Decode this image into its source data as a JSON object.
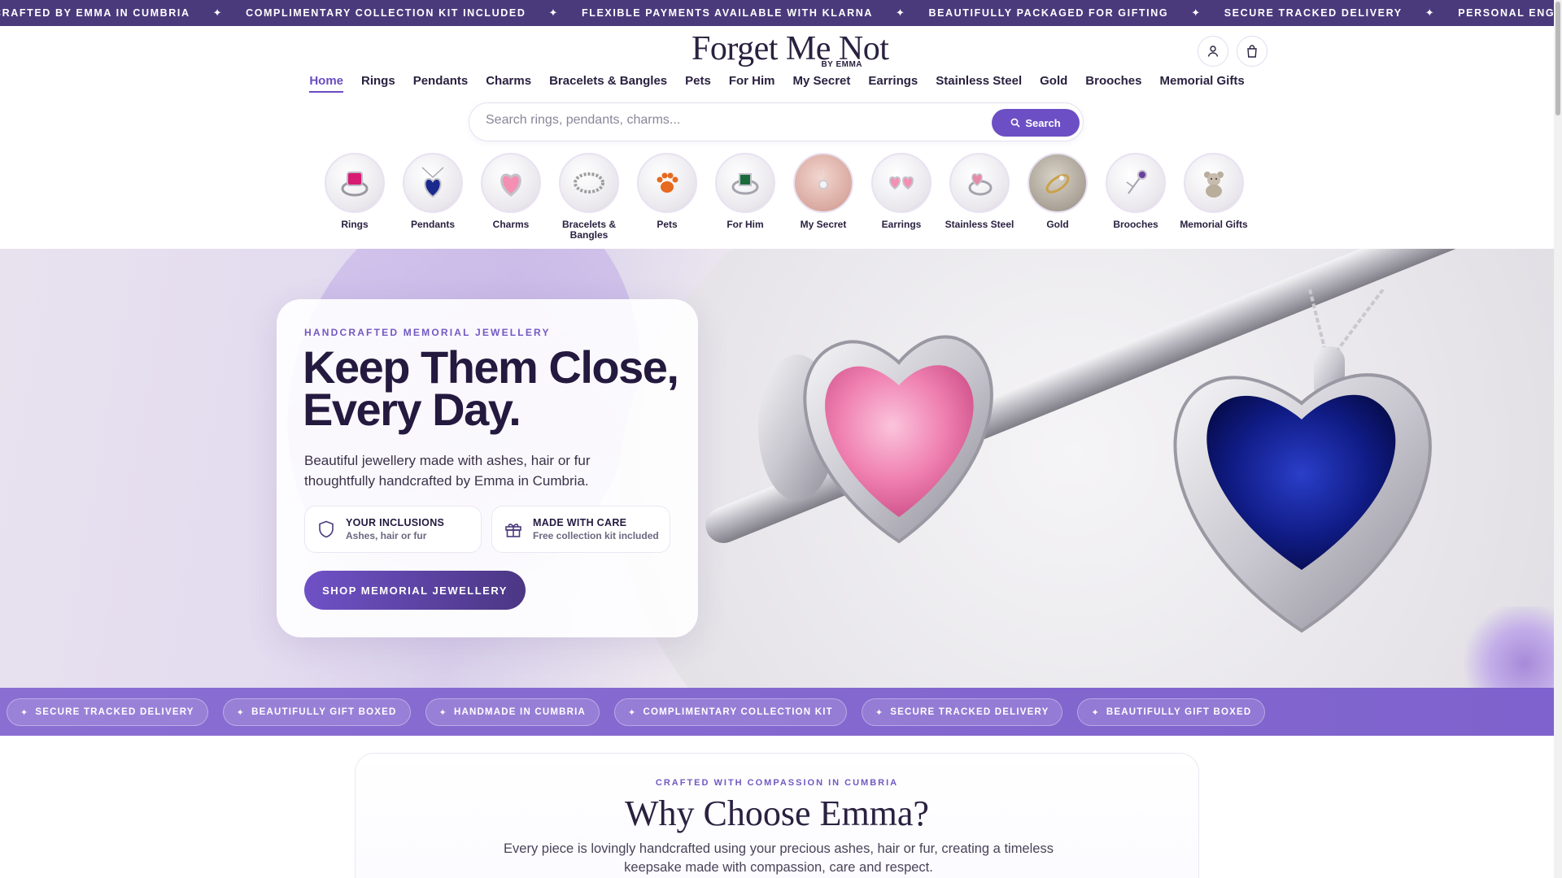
{
  "announcement": {
    "items": [
      "CRAFTED BY EMMA IN CUMBRIA",
      "COMPLIMENTARY COLLECTION KIT INCLUDED",
      "FLEXIBLE PAYMENTS AVAILABLE WITH KLARNA",
      "BEAUTIFULLY PACKAGED FOR GIFTING",
      "SECURE TRACKED DELIVERY",
      "PERSONAL ENGRAVING AVAILABLE"
    ],
    "separator": "✦"
  },
  "header": {
    "logo_main": "Forget Me Not",
    "logo_sub": "BY EMMA",
    "icons": [
      "account-icon",
      "bag-icon"
    ]
  },
  "nav": {
    "items": [
      "Home",
      "Rings",
      "Pendants",
      "Charms",
      "Bracelets & Bangles",
      "Pets",
      "For Him",
      "My Secret",
      "Earrings",
      "Stainless Steel",
      "Gold",
      "Brooches",
      "Memorial Gifts"
    ],
    "active": "Home"
  },
  "search": {
    "placeholder": "Search rings, pendants, charms...",
    "value": "",
    "button_label": "Search"
  },
  "categories": [
    {
      "label": "Rings",
      "icon": "ring-icon",
      "color": "#d81b73"
    },
    {
      "label": "Pendants",
      "icon": "pendant-icon",
      "color": "#1a2a8c"
    },
    {
      "label": "Charms",
      "icon": "charm-icon",
      "color": "#f48fb1"
    },
    {
      "label": "Bracelets & Bangles",
      "icon": "bracelet-icon",
      "color": "#9e9e9e"
    },
    {
      "label": "Pets",
      "icon": "paw-icon",
      "color": "#e66a1f"
    },
    {
      "label": "For Him",
      "icon": "signet-icon",
      "color": "#1b6b3a"
    },
    {
      "label": "My Secret",
      "icon": "secret-icon",
      "color": "#c78a8a"
    },
    {
      "label": "Earrings",
      "icon": "earring-icon",
      "color": "#f48fb1"
    },
    {
      "label": "Stainless Steel",
      "icon": "steel-ring-icon",
      "color": "#e78aa8"
    },
    {
      "label": "Gold",
      "icon": "gold-ring-icon",
      "color": "#c9a24b"
    },
    {
      "label": "Brooches",
      "icon": "brooch-icon",
      "color": "#6a3ea1"
    },
    {
      "label": "Memorial Gifts",
      "icon": "teddy-icon",
      "color": "#b9ad9c"
    }
  ],
  "hero": {
    "eyebrow": "HANDCRAFTED MEMORIAL JEWELLERY",
    "title": "Keep Them Close, Every Day.",
    "description": "Beautiful jewellery made with ashes, hair or fur thoughtfully handcrafted by Emma in Cumbria.",
    "pills": [
      {
        "title": "YOUR INCLUSIONS",
        "subtitle": "Ashes, hair or fur",
        "icon": "shield-icon"
      },
      {
        "title": "MADE WITH CARE",
        "subtitle": "Free collection kit included",
        "icon": "gift-icon"
      }
    ],
    "cta_label": "SHOP MEMORIAL JEWELLERY",
    "accent_color": "#6f51c6"
  },
  "features_strip": {
    "items": [
      "SECURE TRACKED DELIVERY",
      "BEAUTIFULLY GIFT BOXED",
      "HANDMADE IN CUMBRIA",
      "COMPLIMENTARY COLLECTION KIT",
      "SECURE TRACKED DELIVERY",
      "BEAUTIFULLY GIFT BOXED"
    ],
    "separator": "✦"
  },
  "why": {
    "eyebrow": "CRAFTED WITH COMPASSION IN CUMBRIA",
    "title": "Why Choose Emma?",
    "description": "Every piece is lovingly handcrafted using your precious ashes, hair or fur, creating a timeless keepsake made with compassion, care and respect."
  }
}
